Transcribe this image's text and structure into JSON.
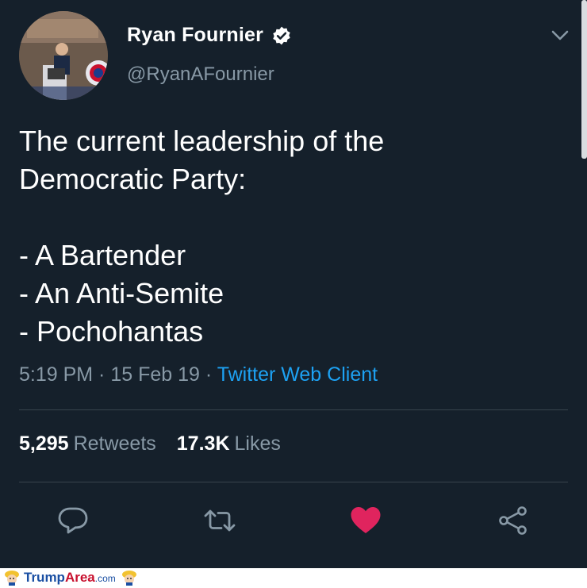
{
  "user": {
    "display_name": "Ryan Fournier",
    "handle": "@RyanAFournier",
    "verified": true
  },
  "tweet": {
    "lines": [
      "The current leadership of the",
      "Democratic Party:",
      "",
      "- A Bartender",
      "- An Anti-Semite",
      "- Pochohantas"
    ],
    "time": "5:19 PM",
    "sep1": " · ",
    "date": "15 Feb 19",
    "sep2": " · ",
    "client": "Twitter Web Client"
  },
  "stats": {
    "retweets_count": "5,295",
    "retweets_label": "Retweets",
    "likes_count": "17.3K",
    "likes_label": "Likes"
  },
  "actions": [
    {
      "icon": "reply-icon"
    },
    {
      "icon": "retweet-icon"
    },
    {
      "icon": "like-icon",
      "active": true
    },
    {
      "icon": "share-icon"
    }
  ],
  "colors": {
    "background": "#15202b",
    "secondary_text": "#8899a6",
    "link": "#1da1f2",
    "like_active": "#e0245e",
    "divider": "#38444d"
  },
  "footer": {
    "brand_part1": "Trump",
    "brand_part2": "Area",
    "brand_part3": ".com"
  }
}
